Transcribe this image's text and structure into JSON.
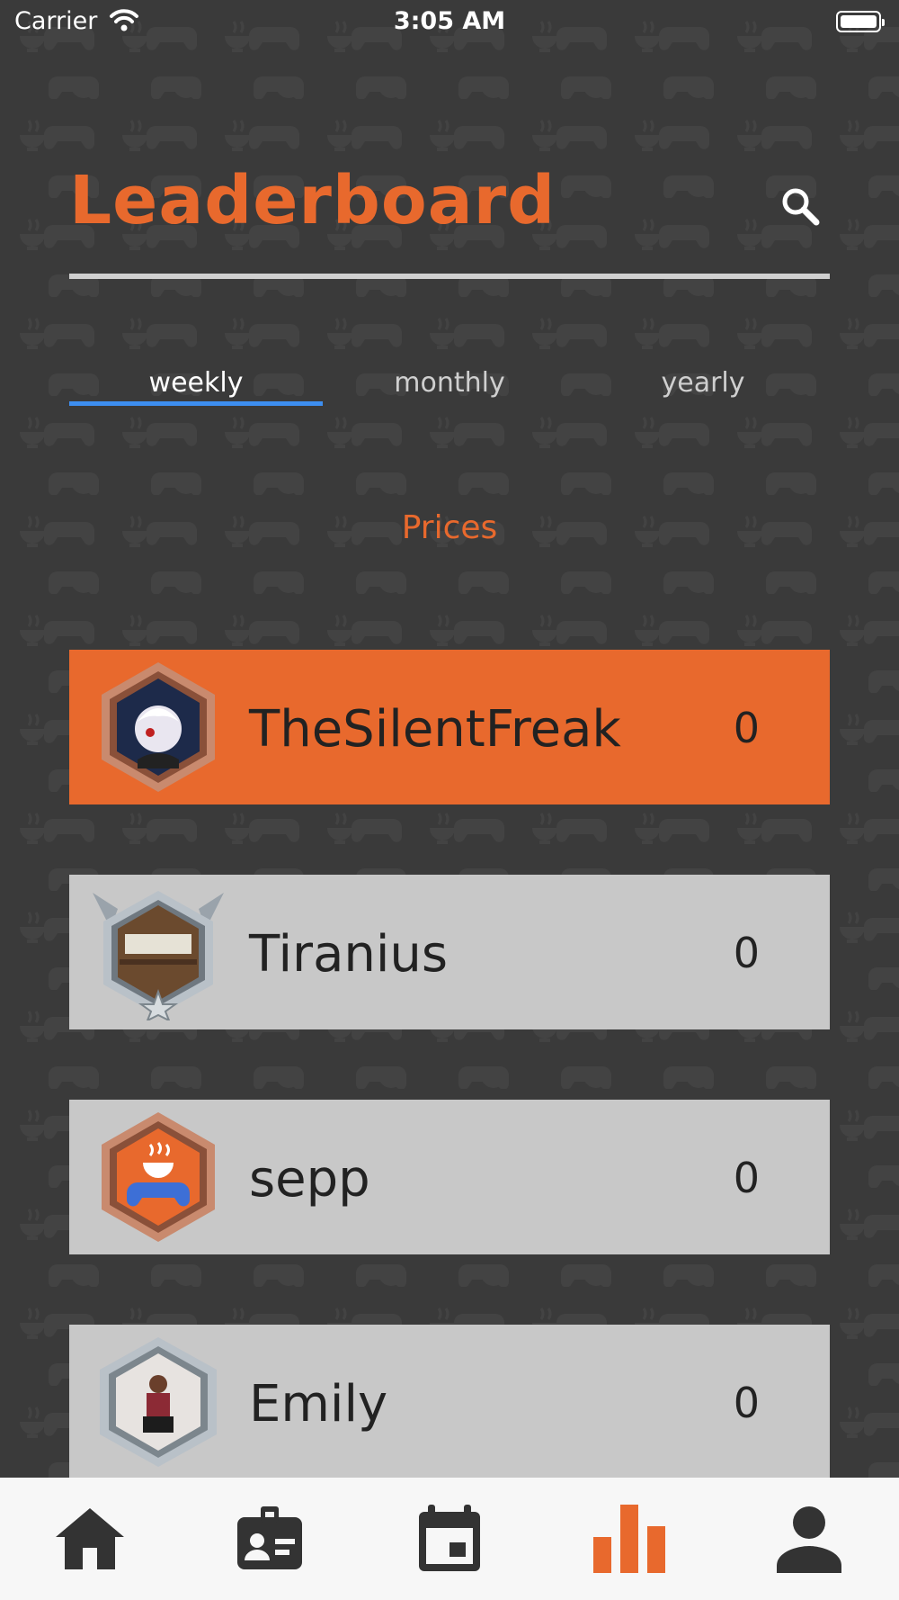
{
  "status_bar": {
    "carrier": "Carrier",
    "time": "3:05 AM"
  },
  "header": {
    "title": "Leaderboard",
    "search_icon": "search-icon"
  },
  "tabs": [
    {
      "label": "weekly",
      "active": true
    },
    {
      "label": "monthly",
      "active": false
    },
    {
      "label": "yearly",
      "active": false
    }
  ],
  "section_label": "Prices",
  "colors": {
    "accent": "#e8692d",
    "background": "#3a3a3a",
    "row_default": "#c8c8c8",
    "tab_indicator": "#3d8ef0",
    "nav_active": "#e8692d",
    "nav_inactive": "#333333"
  },
  "leaderboard": [
    {
      "name": "TheSilentFreak",
      "score": "0",
      "badge": "bronze-hexagon-avatar",
      "highlighted": true
    },
    {
      "name": "Tiranius",
      "score": "0",
      "badge": "silver-winged-avatar",
      "highlighted": false
    },
    {
      "name": "sepp",
      "score": "0",
      "badge": "bronze-hexagon-gamepad-avatar",
      "highlighted": false
    },
    {
      "name": "Emily",
      "score": "0",
      "badge": "silver-hexagon-avatar",
      "highlighted": false
    }
  ],
  "bottom_nav": [
    {
      "icon": "home-icon",
      "active": false
    },
    {
      "icon": "id-card-icon",
      "active": false
    },
    {
      "icon": "calendar-icon",
      "active": false
    },
    {
      "icon": "bar-chart-icon",
      "active": true
    },
    {
      "icon": "person-icon",
      "active": false
    }
  ]
}
